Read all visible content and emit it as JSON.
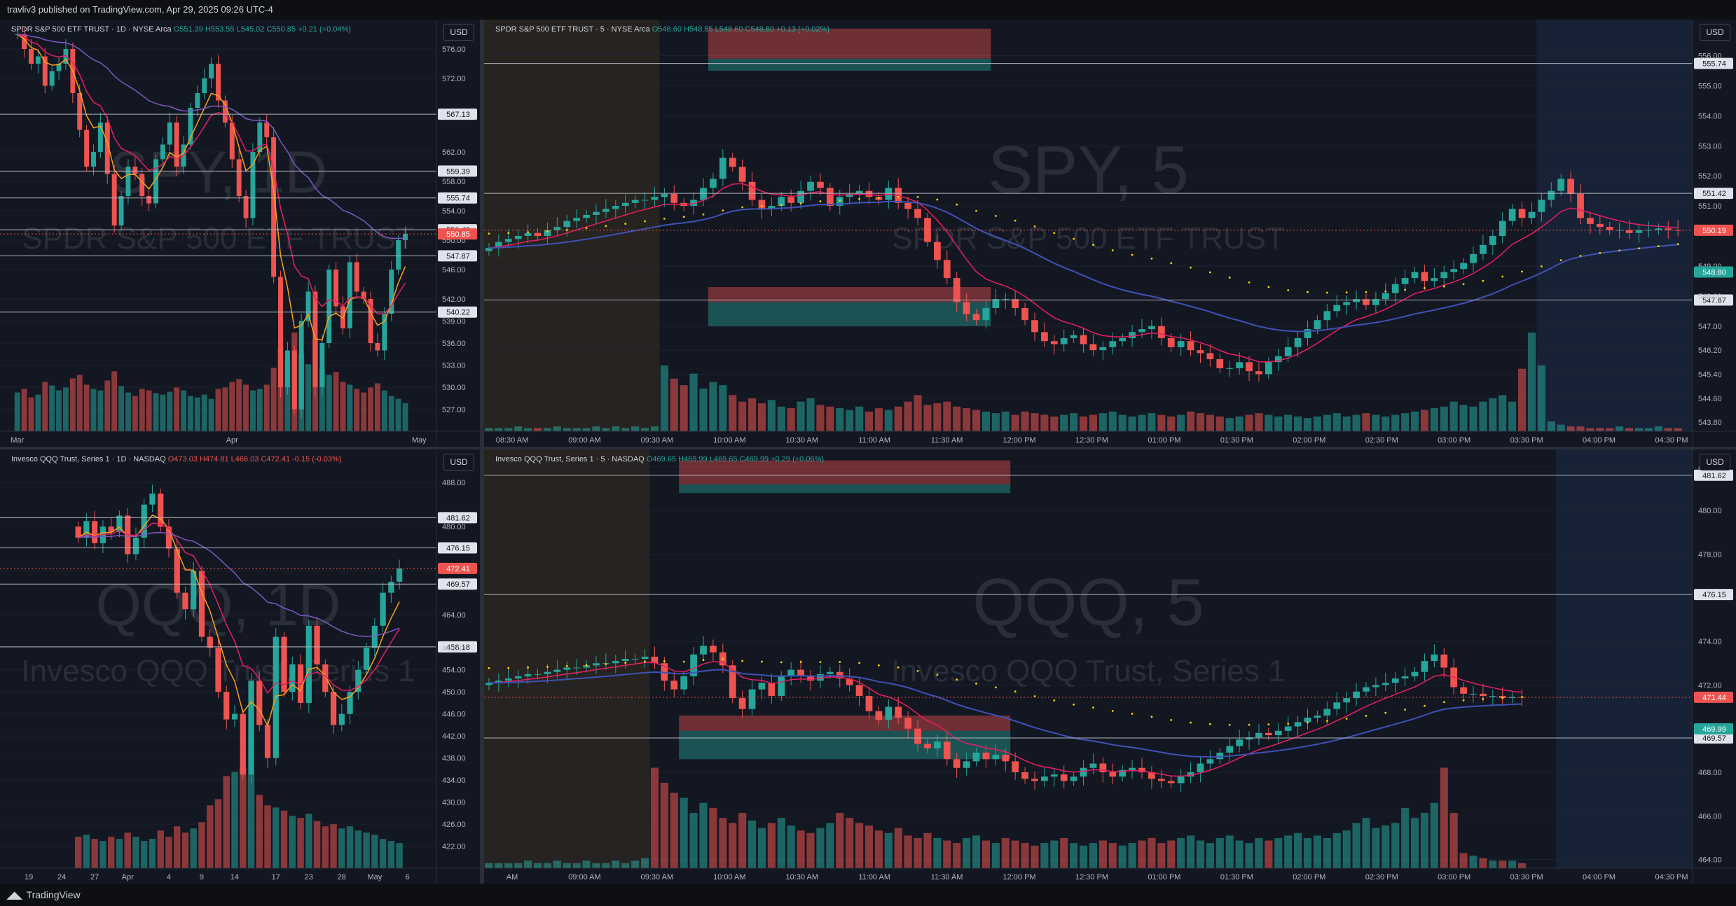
{
  "header": {
    "publisher_line": "travliv3 published on TradingView.com, Apr 29, 2025 09:26 UTC-4"
  },
  "footer": {
    "brand": "TradingView"
  },
  "currency_label": "USD",
  "colors": {
    "up": "#26a69a",
    "down": "#ef5350",
    "ema_short": "#f7a21b",
    "ema_mid": "#e91e63",
    "ema_long": "#7e57c2",
    "vwap": "#ffd600",
    "hline": "#b2b5be",
    "bg": "#131722"
  },
  "chart_data": [
    {
      "id": "spy-daily",
      "type": "candlestick",
      "title": "SPDR S&P 500 ETF TRUST · 1D · NYSE Arca",
      "watermark_symbol": "SPY, 1D",
      "watermark_name": "SPDR S&P 500 ETF TRUST",
      "ohlc_text": {
        "o": "O551.39",
        "h": "H553.55",
        "l": "L545.02",
        "c": "C550.85",
        "chg": "+0.21 (+0.04%)"
      },
      "ylim": [
        524,
        580
      ],
      "y_ticks": [
        "576.00",
        "572.00",
        "562.00",
        "558.00",
        "554.00",
        "550.00",
        "546.00",
        "542.00",
        "539.00",
        "536.00",
        "533.00",
        "530.00",
        "527.00"
      ],
      "x_ticks": [
        "Mar",
        "Apr",
        "May"
      ],
      "x_tick_index": [
        2,
        33,
        60
      ],
      "n_slots": 63,
      "hlines": [
        567.13,
        559.39,
        555.74,
        551.42,
        547.87,
        540.22
      ],
      "hline_labels": [
        "567.13",
        "559.39",
        "555.74",
        "551.42",
        "547.87",
        "540.22"
      ],
      "last_price": 550.85,
      "last_price_label": "550.85",
      "start": 578,
      "closes": [
        578,
        576,
        574,
        575,
        571,
        573,
        574,
        576,
        570,
        565,
        560,
        562,
        566,
        559,
        552,
        556,
        560,
        559,
        556,
        555,
        561,
        563,
        566,
        560,
        563,
        568,
        570,
        572,
        574,
        569,
        566,
        561,
        556,
        553,
        562,
        566,
        564,
        545,
        530,
        535,
        527,
        539,
        543,
        530,
        536,
        546,
        541,
        538,
        547,
        543,
        542,
        536,
        535,
        540,
        546,
        550,
        550.85
      ],
      "volumes": [
        55,
        60,
        48,
        52,
        70,
        65,
        58,
        62,
        75,
        80,
        66,
        60,
        58,
        72,
        85,
        64,
        55,
        50,
        60,
        58,
        54,
        52,
        56,
        62,
        58,
        50,
        48,
        52,
        46,
        60,
        62,
        70,
        74,
        66,
        58,
        60,
        66,
        90,
        120,
        100,
        140,
        110,
        95,
        130,
        88,
        80,
        84,
        70,
        66,
        60,
        55,
        62,
        68,
        58,
        50,
        46,
        40
      ]
    },
    {
      "id": "spy-5m",
      "type": "candlestick",
      "title": "SPDR S&P 500 ETF TRUST · 5 · NYSE Arca",
      "watermark_symbol": "SPY, 5",
      "watermark_name": "SPDR S&P 500 ETF TRUST",
      "ohlc_text": {
        "o": "O548.60",
        "h": "H548.85",
        "l": "L548.60",
        "c": "C548.80",
        "chg": "+0.13 (+0.02%)"
      },
      "ylim": [
        543.5,
        557.2
      ],
      "y_ticks": [
        "556.00",
        "555.00",
        "554.00",
        "553.00",
        "552.00",
        "551.00",
        "549.00",
        "548.00",
        "547.00",
        "546.20",
        "545.40",
        "544.60",
        "543.80"
      ],
      "x_ticks": [
        "08:30 AM",
        "09:00 AM",
        "09:30 AM",
        "10:00 AM",
        "10:30 AM",
        "11:00 AM",
        "11:30 AM",
        "12:00 PM",
        "12:30 PM",
        "01:00 PM",
        "01:30 PM",
        "02:00 PM",
        "02:30 PM",
        "03:00 PM",
        "03:30 PM",
        "04:00 PM",
        "04:30 PM"
      ],
      "session_pre_end_slot": 18,
      "session_post_start_slot": 108,
      "n_slots": 124,
      "hlines": [
        555.74,
        551.42,
        547.87
      ],
      "hline_labels": [
        "555.74",
        "551.42",
        "547.87"
      ],
      "zones": [
        {
          "from_slot": 23,
          "to_slot": 52,
          "top": 556.9,
          "mid": 555.9,
          "bottom": 555.5
        },
        {
          "from_slot": 23,
          "to_slot": 52,
          "top": 548.3,
          "mid": 547.8,
          "bottom": 547.0
        }
      ],
      "last_price": 550.19,
      "last_price_label": "550.19",
      "vwap_label": "548.80",
      "start": 549.5,
      "closes": [
        549.6,
        549.8,
        549.9,
        550.0,
        550.1,
        550.0,
        550.2,
        550.3,
        550.5,
        550.6,
        550.7,
        550.8,
        550.9,
        551.0,
        551.1,
        551.2,
        551.2,
        551.3,
        551.4,
        551.1,
        551.0,
        551.2,
        551.6,
        551.9,
        552.6,
        552.3,
        551.8,
        551.2,
        550.9,
        551.0,
        551.3,
        551.1,
        551.5,
        551.8,
        551.6,
        551.0,
        551.3,
        551.4,
        551.5,
        551.3,
        551.2,
        551.6,
        551.1,
        550.9,
        550.6,
        549.8,
        549.2,
        548.6,
        547.8,
        547.4,
        547.2,
        547.6,
        547.9,
        547.9,
        547.6,
        547.2,
        546.8,
        546.5,
        546.4,
        546.6,
        546.7,
        546.4,
        546.2,
        546.3,
        546.5,
        546.6,
        546.8,
        546.9,
        547.0,
        546.6,
        546.3,
        546.5,
        546.2,
        546.1,
        545.9,
        545.6,
        545.6,
        545.8,
        545.5,
        545.4,
        545.8,
        546.0,
        546.3,
        546.6,
        546.9,
        547.2,
        547.5,
        547.7,
        547.8,
        547.9,
        547.7,
        547.9,
        548.1,
        548.4,
        548.6,
        548.8,
        548.5,
        548.6,
        548.8,
        548.9,
        549.1,
        549.4,
        549.7,
        550.0,
        550.5,
        550.9,
        550.6,
        550.8,
        551.2,
        551.5,
        551.9,
        551.4,
        550.6,
        550.4,
        550.3,
        550.2,
        550.2,
        550.1,
        550.2,
        550.2,
        550.25,
        550.2,
        550.19
      ],
      "volumes": [
        2,
        2,
        2,
        3,
        2,
        2,
        2,
        3,
        2,
        2,
        2,
        3,
        2,
        3,
        2,
        3,
        2,
        3,
        40,
        32,
        28,
        35,
        26,
        30,
        28,
        22,
        18,
        20,
        17,
        19,
        15,
        14,
        18,
        20,
        16,
        15,
        14,
        13,
        15,
        12,
        14,
        13,
        15,
        18,
        22,
        16,
        17,
        18,
        15,
        14,
        13,
        12,
        11,
        12,
        10,
        12,
        11,
        10,
        9,
        10,
        11,
        9,
        10,
        11,
        12,
        10,
        9,
        10,
        11,
        10,
        9,
        10,
        12,
        11,
        10,
        9,
        8,
        9,
        10,
        11,
        10,
        9,
        10,
        9,
        8,
        9,
        10,
        11,
        9,
        10,
        11,
        10,
        9,
        10,
        11,
        12,
        13,
        14,
        15,
        18,
        16,
        15,
        18,
        20,
        22,
        18,
        38,
        60,
        40,
        6,
        4,
        3,
        3,
        2,
        2,
        2,
        3,
        2,
        2,
        2,
        3,
        2,
        2
      ]
    },
    {
      "id": "qqq-daily",
      "type": "candlestick",
      "title": "Invesco QQQ Trust, Series 1 · 1D · NASDAQ",
      "watermark_symbol": "QQQ, 1D",
      "watermark_name": "Invesco QQQ Trust, Series 1",
      "ohlc_text": {
        "o": "O473.03",
        "h": "H474.81",
        "l": "L466.03",
        "c": "C472.41",
        "chg": "-0.15 (-0.03%)"
      },
      "ylim": [
        418,
        494
      ],
      "y_ticks": [
        "488.00",
        "480.00",
        "472.00",
        "464.00",
        "458.00",
        "454.00",
        "450.00",
        "446.00",
        "442.00",
        "438.00",
        "434.00",
        "430.00",
        "426.00",
        "422.00"
      ],
      "x_ticks": [
        "19",
        "24",
        "27",
        "Apr",
        "4",
        "9",
        "14",
        "17",
        "23",
        "28",
        "May",
        "6"
      ],
      "x_tick_index": [
        3,
        7,
        11,
        15,
        20,
        24,
        28,
        33,
        37,
        41,
        45,
        49
      ],
      "n_slots": 53,
      "hlines": [
        481.62,
        476.15,
        469.57,
        458.18
      ],
      "hline_labels": [
        "481.62",
        "476.15",
        "469.57",
        "458.18"
      ],
      "last_price": 472.41,
      "last_price_label": "472.41",
      "start": 480,
      "closes": [
        478,
        481,
        477,
        480,
        479,
        482,
        475,
        478,
        484,
        486,
        480,
        476,
        468,
        465,
        472,
        460,
        458,
        450,
        445,
        446,
        435,
        452,
        444,
        438,
        460,
        450,
        455,
        448,
        462,
        455,
        450,
        444,
        446,
        450,
        454,
        458,
        462,
        468,
        470,
        472.41
      ],
      "volumes": [
        30,
        32,
        28,
        26,
        30,
        28,
        34,
        30,
        26,
        28,
        36,
        30,
        40,
        34,
        38,
        44,
        60,
        66,
        88,
        92,
        96,
        90,
        70,
        60,
        58,
        55,
        50,
        48,
        52,
        45,
        40,
        42,
        38,
        40,
        36,
        34,
        32,
        28,
        26,
        24
      ]
    },
    {
      "id": "qqq-5m",
      "type": "candlestick",
      "title": "Invesco QQQ Trust, Series 1 · 5 · NASDAQ",
      "watermark_symbol": "QQQ, 5",
      "watermark_name": "Invesco QQQ Trust, Series 1",
      "ohlc_text": {
        "o": "O469.65",
        "h": "H469.99",
        "l": "L469.65",
        "c": "C469.99",
        "chg": "+0.29 (+0.06%)"
      },
      "ylim": [
        463.6,
        482.8
      ],
      "y_ticks": [
        "482.00",
        "480.00",
        "478.00",
        "474.00",
        "472.00",
        "468.00",
        "466.00",
        "464.00"
      ],
      "x_ticks": [
        "AM",
        "09:00 AM",
        "09:30 AM",
        "10:00 AM",
        "10:30 AM",
        "11:00 AM",
        "11:30 AM",
        "12:00 PM",
        "12:30 PM",
        "01:00 PM",
        "01:30 PM",
        "02:00 PM",
        "02:30 PM",
        "03:00 PM",
        "03:30 PM",
        "04:00 PM",
        "04:30 PM"
      ],
      "session_pre_end_slot": 17,
      "session_post_start_slot": 110,
      "n_slots": 124,
      "hlines": [
        481.62,
        476.15,
        469.57
      ],
      "hline_labels": [
        "481.62",
        "476.15",
        "469.57"
      ],
      "zones": [
        {
          "from_slot": 20,
          "to_slot": 54,
          "top": 482.3,
          "mid": 481.2,
          "bottom": 480.8
        },
        {
          "from_slot": 20,
          "to_slot": 54,
          "top": 470.6,
          "mid": 469.9,
          "bottom": 468.6
        }
      ],
      "last_price": 471.44,
      "last_price_label": "471.44",
      "vwap_label": "469.99",
      "start": 472.0,
      "closes": [
        472.1,
        472.2,
        472.3,
        472.4,
        472.5,
        472.5,
        472.6,
        472.7,
        472.8,
        472.8,
        472.9,
        473.0,
        473.0,
        473.1,
        473.2,
        473.2,
        473.3,
        473.0,
        472.2,
        471.8,
        472.4,
        473.4,
        473.8,
        473.5,
        472.9,
        471.4,
        470.9,
        471.8,
        472.1,
        471.5,
        472.4,
        472.7,
        472.4,
        472.2,
        472.5,
        472.6,
        472.3,
        472.0,
        471.5,
        470.8,
        470.4,
        471.0,
        470.5,
        470.0,
        469.3,
        469.1,
        469.4,
        468.6,
        468.2,
        468.5,
        468.9,
        468.6,
        468.8,
        468.5,
        468.0,
        467.7,
        467.6,
        467.8,
        467.9,
        467.6,
        467.8,
        468.2,
        468.4,
        468.0,
        467.8,
        468.1,
        468.2,
        468.0,
        467.7,
        467.6,
        467.5,
        467.8,
        468.0,
        468.4,
        468.6,
        468.9,
        469.2,
        469.5,
        469.6,
        469.8,
        469.7,
        469.9,
        470.1,
        470.3,
        470.5,
        470.6,
        470.9,
        471.2,
        471.4,
        471.7,
        471.9,
        472.0,
        472.1,
        472.3,
        472.4,
        472.6,
        473.1,
        473.4,
        472.8,
        471.9,
        471.6,
        471.6,
        471.5,
        471.5,
        471.4,
        471.45,
        471.44
      ],
      "volumes": [
        2,
        2,
        2,
        2,
        3,
        2,
        2,
        3,
        2,
        2,
        3,
        2,
        2,
        3,
        2,
        3,
        4,
        40,
        34,
        30,
        28,
        22,
        26,
        24,
        20,
        18,
        22,
        19,
        16,
        18,
        20,
        17,
        15,
        14,
        16,
        18,
        22,
        20,
        18,
        17,
        15,
        14,
        16,
        13,
        12,
        14,
        12,
        11,
        10,
        12,
        13,
        11,
        10,
        12,
        11,
        10,
        9,
        10,
        11,
        12,
        10,
        9,
        10,
        11,
        10,
        9,
        10,
        11,
        12,
        10,
        11,
        12,
        13,
        11,
        10,
        12,
        13,
        11,
        10,
        12,
        11,
        12,
        13,
        14,
        12,
        13,
        12,
        14,
        15,
        18,
        20,
        16,
        17,
        18,
        24,
        20,
        22,
        26,
        40,
        22,
        6,
        5,
        4,
        3,
        3,
        3,
        2,
        2
      ]
    }
  ]
}
